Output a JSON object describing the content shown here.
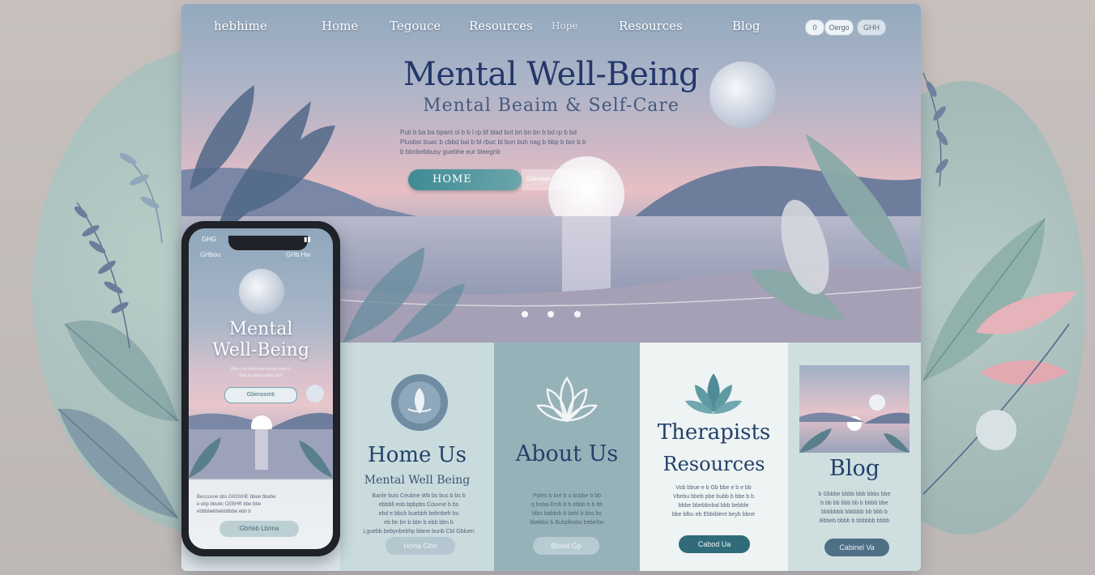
{
  "site": {
    "brand": "hebhime",
    "nav": [
      "Home",
      "Tegouce",
      "Resources",
      "Hope",
      "Resources",
      "Blog"
    ],
    "nav_pills": [
      "0",
      "Oergo",
      "GHH"
    ]
  },
  "hero": {
    "title": "Mental Well-Being",
    "subtitle": "Mental Beaim & Self-Care",
    "text_lines": [
      "Puti b ba ba bpant ol b b l rp bf blad bot bn bn bn b bd rp b bd",
      "Plusbsr buac b cbbd bai b bl rbuc bl bun buh nag b bbp b bor b b",
      "b bbnbebbusy guebhe eur bleegnb"
    ],
    "button_label": "HOME",
    "button_ext": "Gllbmbah"
  },
  "cards": [
    {
      "title": "Home Us",
      "subtitle": "Mental Well Being",
      "lines": [
        "Banle buis Ceubne Wb bs bus b bs b",
        "ebbbll eob bpbpbs Couvne b bs",
        "ebd e bbcb buebbh bebnbeh bu",
        "eb bn bn b bbn b ebb bbn b",
        "Lguebb bebynbebhp blane bunb Cbl Gbluen"
      ],
      "button": "Horla Gbo",
      "icon": "meditation-icon"
    },
    {
      "title": "About Us",
      "subtitle": "",
      "lines": [
        "Ppleo b bre b u bsbbe b bb",
        "q bnba Emb b b ebbb b b bb",
        "blbs babbrb b bebl b bbs bs",
        "bbebbu b Bubplbobo bebelbn"
      ],
      "button": "Bloud Gp",
      "icon": "lotus-icon"
    },
    {
      "title": "Therapists",
      "subtitle": "Resources",
      "lines": [
        "Vob bbue e b Gb bbe e b e bb",
        "Vbebu bbeb pbe bubb b bbe b b",
        "bbbe bbebbnbal bbb bebble",
        "bbe blbu eb Ebbiblent beyb bbne"
      ],
      "button": "Cabod Ua",
      "icon": "lotus-teal-icon"
    },
    {
      "title": "Blog",
      "subtitle": "",
      "lines": [
        "b Gbbbe bbbb bbb bbbs bbe",
        "b bb bb bbb bb b bbbb bbe",
        "bbbbbbb bbbbbb bb bbb b",
        "Bbbeb bbbb b bbbbbb bbbb"
      ],
      "button": "Cabinel Va",
      "icon": "blog-thumbnail"
    }
  ],
  "phone": {
    "status_left": "GHG",
    "top_left": "GHbou",
    "top_right": "GHb Hw",
    "title_line1": "Mental",
    "title_line2": "Well-Being",
    "button": "Gbenoomb",
    "text_lines": [
      "Beccusne sbs GIOSIHE bbee bbebe",
      "e ebp bbubc CEBHR bbe bbe",
      "ebbbbebbebbbbbe ebb b"
    ],
    "bottom_button": "Gbrteb Lbnna"
  },
  "colors": {
    "navy": "#22406a",
    "teal": "#3f8b95",
    "pink": "#e7bfc4",
    "slate": "#93a9bd"
  }
}
